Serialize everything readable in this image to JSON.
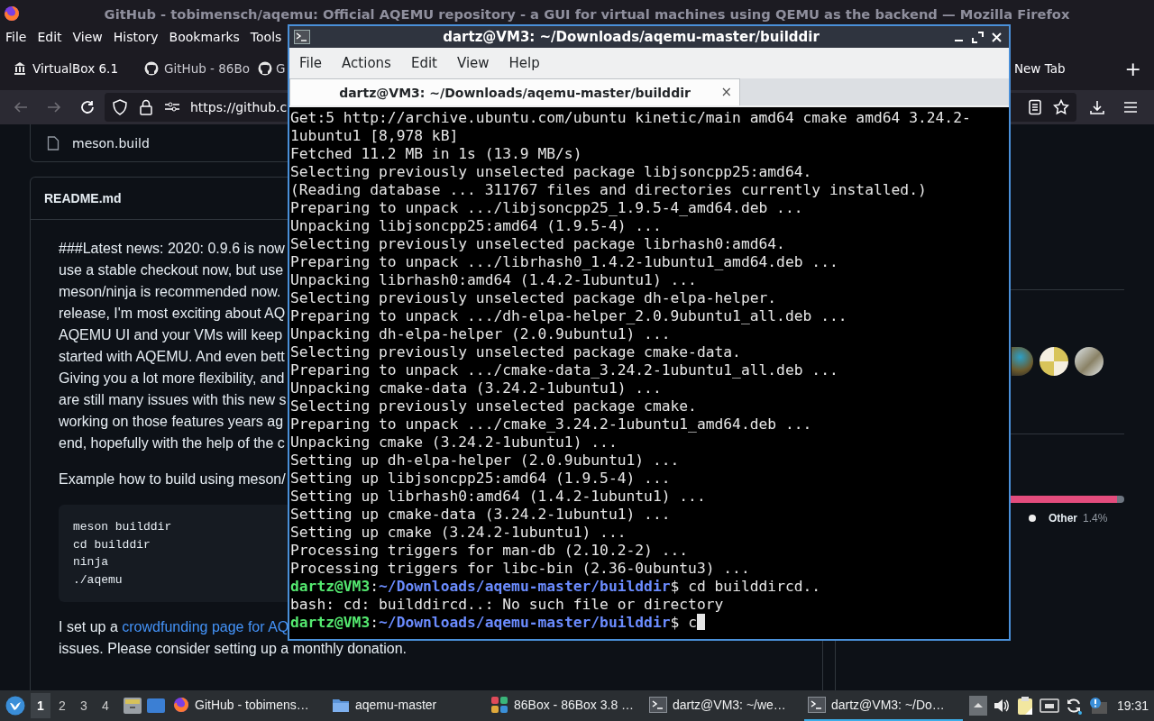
{
  "browser": {
    "title": "GitHub - tobimensch/aqemu: Official AQEMU repository - a GUI for virtual machines using QEMU as the backend — Mozilla Firefox",
    "menu": [
      "File",
      "Edit",
      "View",
      "History",
      "Bookmarks",
      "Tools"
    ],
    "tabs": [
      {
        "label": "VirtualBox 6.1",
        "selected": false
      },
      {
        "label": "GitHub - 86Bo",
        "selected": false
      },
      {
        "label": "G",
        "selected": false
      },
      {
        "label": "New Tab",
        "selected": false
      }
    ],
    "add_tab": "+",
    "url": "https://github.c",
    "files": [
      "meson.build"
    ],
    "readme": {
      "title": "README.md",
      "lines": [
        "###Latest news: 2020: 0.9.6 is now",
        "use a stable checkout now, but use",
        "meson/ninja is recommended now.",
        "release, I'm most exciting about AQ",
        "AQEMU UI and your VMs will keep",
        "started with AQEMU. And even bett",
        "Giving you a lot more flexibility, and",
        "are still many issues with this new s",
        "working on those features years ag",
        "end, hopefully with the help of the c"
      ],
      "example": "Example how to build using meson/",
      "code": [
        "meson builddir",
        "cd builddir",
        "ninja",
        "./aqemu"
      ],
      "crowd_text": "I set up a ",
      "crowd_link": "crowdfunding page for AQ",
      "after": "issues. Please consider setting up a monthly donation."
    },
    "sidebar": {
      "contributors": [
        {
          "kind": "globe"
        },
        {
          "kind": "pattern"
        },
        {
          "kind": "bird"
        }
      ],
      "languages": {
        "level": 0.94,
        "legend": [
          {
            "name": "Other",
            "percent": "1.4%",
            "color": "#ededed"
          }
        ]
      }
    }
  },
  "terminal": {
    "title": "dartz@VM3: ~/Downloads/aqemu-master/builddir",
    "menu": [
      "File",
      "Actions",
      "Edit",
      "View",
      "Help"
    ],
    "tab": {
      "label": "dartz@VM3: ~/Downloads/aqemu-master/builddir",
      "close": "×"
    },
    "lines": [
      {
        "kind": "output",
        "text": "Get:5 http://archive.ubuntu.com/ubuntu kinetic/main amd64 cmake amd64 3.24.2-"
      },
      {
        "kind": "output",
        "text": "1ubuntu1 [8,978 kB]"
      },
      {
        "kind": "output",
        "text": "Fetched 11.2 MB in 1s (13.9 MB/s)"
      },
      {
        "kind": "output",
        "text": "Selecting previously unselected package libjsoncpp25:amd64."
      },
      {
        "kind": "output",
        "text": "(Reading database ... 311767 files and directories currently installed.)"
      },
      {
        "kind": "output",
        "text": "Preparing to unpack .../libjsoncpp25_1.9.5-4_amd64.deb ..."
      },
      {
        "kind": "output",
        "text": "Unpacking libjsoncpp25:amd64 (1.9.5-4) ..."
      },
      {
        "kind": "output",
        "text": "Selecting previously unselected package librhash0:amd64."
      },
      {
        "kind": "output",
        "text": "Preparing to unpack .../librhash0_1.4.2-1ubuntu1_amd64.deb ..."
      },
      {
        "kind": "output",
        "text": "Unpacking librhash0:amd64 (1.4.2-1ubuntu1) ..."
      },
      {
        "kind": "output",
        "text": "Selecting previously unselected package dh-elpa-helper."
      },
      {
        "kind": "output",
        "text": "Preparing to unpack .../dh-elpa-helper_2.0.9ubuntu1_all.deb ..."
      },
      {
        "kind": "output",
        "text": "Unpacking dh-elpa-helper (2.0.9ubuntu1) ..."
      },
      {
        "kind": "output",
        "text": "Selecting previously unselected package cmake-data."
      },
      {
        "kind": "output",
        "text": "Preparing to unpack .../cmake-data_3.24.2-1ubuntu1_all.deb ..."
      },
      {
        "kind": "output",
        "text": "Unpacking cmake-data (3.24.2-1ubuntu1) ..."
      },
      {
        "kind": "output",
        "text": "Selecting previously unselected package cmake."
      },
      {
        "kind": "output",
        "text": "Preparing to unpack .../cmake_3.24.2-1ubuntu1_amd64.deb ..."
      },
      {
        "kind": "output",
        "text": "Unpacking cmake (3.24.2-1ubuntu1) ..."
      },
      {
        "kind": "output",
        "text": "Setting up dh-elpa-helper (2.0.9ubuntu1) ..."
      },
      {
        "kind": "output",
        "text": "Setting up libjsoncpp25:amd64 (1.9.5-4) ..."
      },
      {
        "kind": "output",
        "text": "Setting up librhash0:amd64 (1.4.2-1ubuntu1) ..."
      },
      {
        "kind": "output",
        "text": "Setting up cmake-data (3.24.2-1ubuntu1) ..."
      },
      {
        "kind": "output",
        "text": "Setting up cmake (3.24.2-1ubuntu1) ..."
      },
      {
        "kind": "output",
        "text": "Processing triggers for man-db (2.10.2-2) ..."
      },
      {
        "kind": "output",
        "text": "Processing triggers for libc-bin (2.36-0ubuntu3) ..."
      },
      {
        "kind": "prompt",
        "user": "dartz@VM3",
        "sep": ":",
        "path": "~/Downloads/aqemu-master/builddir",
        "command": "$ cd builddircd..",
        "cursor": false
      },
      {
        "kind": "output",
        "text": "bash: cd: builddircd..: No such file or directory"
      },
      {
        "kind": "prompt",
        "user": "dartz@VM3",
        "sep": ":",
        "path": "~/Downloads/aqemu-master/builddir",
        "command": "$ c",
        "cursor": true
      }
    ]
  },
  "taskbar": {
    "workspaces": [
      {
        "label": "1",
        "selected": true
      },
      {
        "label": "2",
        "selected": false
      },
      {
        "label": "3",
        "selected": false
      },
      {
        "label": "4",
        "selected": false
      }
    ],
    "tasks": [
      {
        "label": "GitHub - tobimens…",
        "selected": false
      },
      {
        "label": "aqemu-master",
        "selected": false
      },
      {
        "label": "86Box - 86Box 3.8 …",
        "selected": false
      },
      {
        "label": "dartz@VM3: ~/we…",
        "selected": false
      },
      {
        "label": "dartz@VM3: ~/Do…",
        "selected": true
      }
    ],
    "clock": "19:31"
  }
}
